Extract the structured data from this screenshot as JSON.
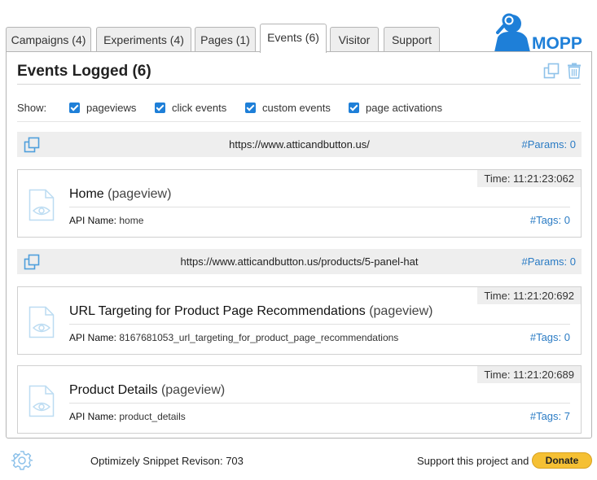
{
  "tabs": [
    {
      "label": "Campaigns (4)"
    },
    {
      "label": "Experiments (4)"
    },
    {
      "label": "Pages (1)"
    },
    {
      "label": "Events (6)",
      "active": true
    },
    {
      "label": "Visitor"
    },
    {
      "label": "Support"
    }
  ],
  "logo": {
    "text": "MOPPI",
    "color": "#1e7fd8"
  },
  "panel": {
    "title": "Events Logged (6)",
    "icons": [
      "copy-icon",
      "trash-icon"
    ]
  },
  "filters": {
    "show_label": "Show:",
    "options": [
      {
        "label": "pageviews",
        "checked": true
      },
      {
        "label": "click events",
        "checked": true
      },
      {
        "label": "custom events",
        "checked": true
      },
      {
        "label": "page activations",
        "checked": true
      }
    ]
  },
  "groups": [
    {
      "url": "https://www.atticandbutton.us/",
      "params": "#Params: 0",
      "events": [
        {
          "time": "Time: 11:21:23:062",
          "name": "Home",
          "kind": "(pageview)",
          "api_label": "API Name:",
          "api_name": "home",
          "tags": "#Tags: 0"
        }
      ]
    },
    {
      "url": "https://www.atticandbutton.us/products/5-panel-hat",
      "params": "#Params: 0",
      "events": [
        {
          "time": "Time: 11:21:20:692",
          "name": "URL Targeting for Product Page Recommendations",
          "kind": "(pageview)",
          "api_label": "API Name:",
          "api_name": "8167681053_url_targeting_for_product_page_recommendations",
          "tags": "#Tags: 0"
        },
        {
          "time": "Time: 11:21:20:689",
          "name": "Product Details",
          "kind": "(pageview)",
          "api_label": "API Name:",
          "api_name": "product_details",
          "tags": "#Tags: 7"
        }
      ]
    }
  ],
  "footer": {
    "revision_label": "Optimizely Snippet Revison:",
    "revision_value": "703",
    "support_text": "Support this project and",
    "donate_label": "Donate"
  },
  "colors": {
    "accent": "#2a7bc4",
    "checkbox": "#1e7fd8",
    "donate": "#f5c034",
    "bar_bg": "#eeeeee"
  }
}
